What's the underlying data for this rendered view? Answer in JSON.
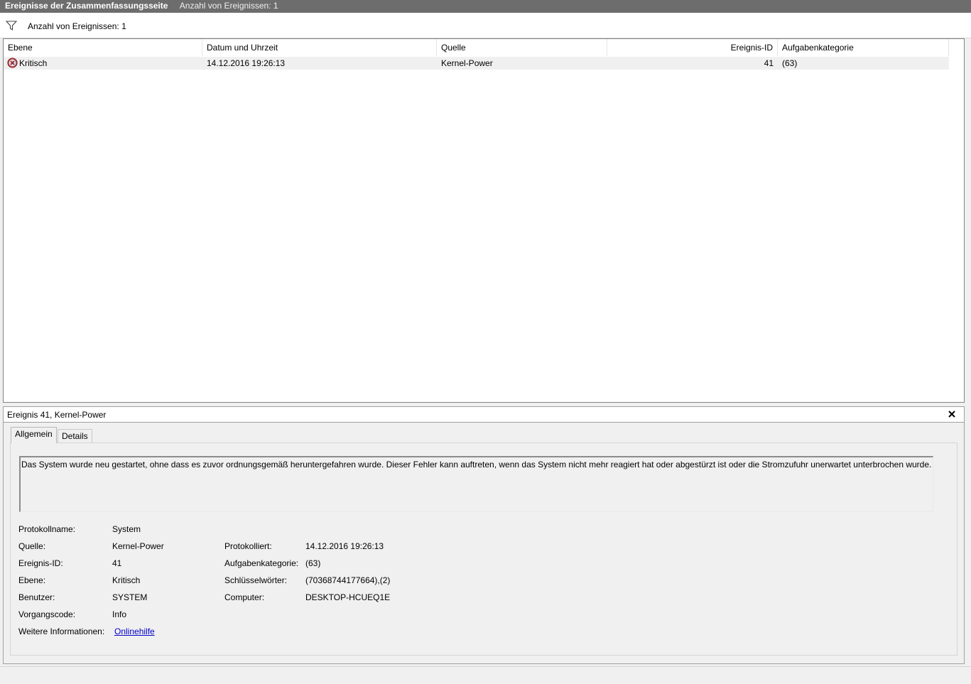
{
  "titlebar": {
    "title": "Ereignisse der Zusammenfassungsseite",
    "count_label": "Anzahl von Ereignissen: 1"
  },
  "filterbar": {
    "icon": "filter-icon",
    "text": "Anzahl von Ereignissen: 1"
  },
  "grid": {
    "columns": [
      "Ebene",
      "Datum und Uhrzeit",
      "Quelle",
      "Ereignis-ID",
      "Aufgabenkategorie"
    ],
    "rows": [
      {
        "level": "Kritisch",
        "level_icon": "critical-error-icon",
        "datetime": "14.12.2016 19:26:13",
        "source": "Kernel-Power",
        "event_id": "41",
        "category": "(63)"
      }
    ]
  },
  "detail": {
    "title": "Ereignis 41, Kernel-Power",
    "close_icon": "close-icon",
    "tabs": [
      "Allgemein",
      "Details"
    ],
    "active_tab": "Allgemein",
    "description": "Das System wurde neu gestartet, ohne dass es zuvor ordnungsgemäß heruntergefahren wurde. Dieser Fehler kann auftreten, wenn das System nicht mehr reagiert hat oder abgestürzt ist oder die Stromzufuhr unerwartet unterbrochen wurde.",
    "fields": {
      "log_name_label": "Protokollname:",
      "log_name": "System",
      "source_label": "Quelle:",
      "source": "Kernel-Power",
      "logged_label": "Protokolliert:",
      "logged": "14.12.2016 19:26:13",
      "event_id_label": "Ereignis-ID:",
      "event_id": "41",
      "task_category_label": "Aufgabenkategorie:",
      "task_category": "(63)",
      "level_label": "Ebene:",
      "level": "Kritisch",
      "keywords_label": "Schlüsselwörter:",
      "keywords": "(70368744177664),(2)",
      "user_label": "Benutzer:",
      "user": "SYSTEM",
      "computer_label": "Computer:",
      "computer": "DESKTOP-HCUEQ1E",
      "opcode_label": "Vorgangscode:",
      "opcode": "Info",
      "more_info_label": "Weitere Informationen:",
      "more_info_link": "Onlinehilfe"
    }
  }
}
